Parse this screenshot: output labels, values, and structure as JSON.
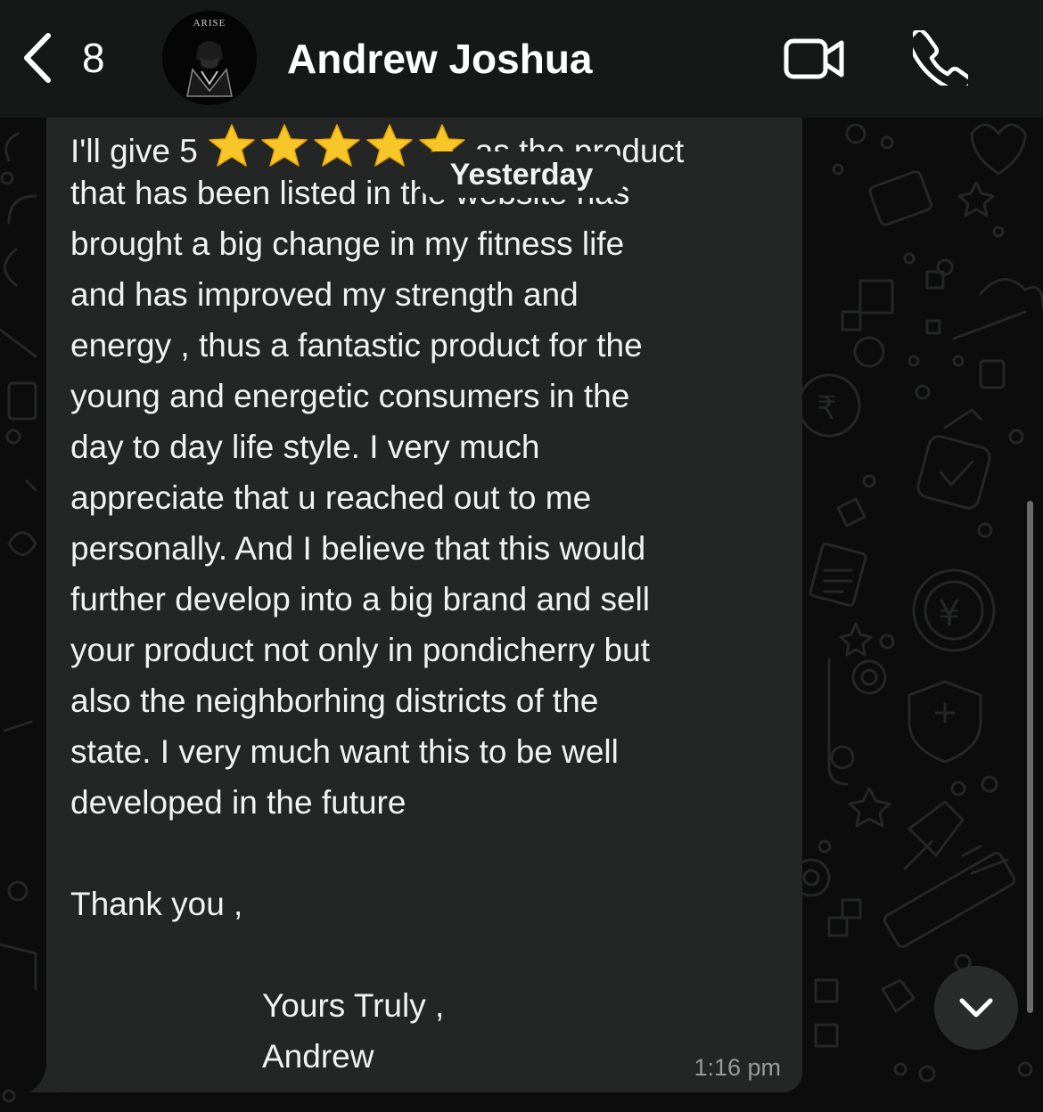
{
  "header": {
    "back_count": "8",
    "avatar_brand": "ARISE",
    "contact_name": "Andrew Joshua"
  },
  "message": {
    "first_line_before_stars": "I'll give 5",
    "star_count": 5,
    "first_line_after_stars": "as the product",
    "body_lines": [
      "that has been listed in the website has",
      "brought a big change in my fitness life",
      "and has improved my strength and",
      "energy , thus a fantastic product for the",
      "young and energetic consumers in the",
      "day to day life style. I very much",
      "appreciate that u reached out to me",
      "personally. And I believe that this would",
      "further develop into a big brand and sell",
      "your product not only in pondicherry but",
      "also the neighborhing districts of the",
      "state. I very much want this to be well",
      "developed in the future"
    ],
    "closing": "Thank you ,",
    "signoff_line1": "Yours Truly ,",
    "signoff_line2": "Andrew",
    "time": "1:16 pm"
  },
  "date_separator": "Yesterday",
  "icons": {
    "back": "chevron-left-icon",
    "video": "video-camera-icon",
    "call": "phone-icon",
    "star": "star-icon",
    "scroll": "chevron-down-icon"
  },
  "colors": {
    "background": "#0c0c0c",
    "header": "#161717",
    "bubble": "#242626",
    "text": "#f2f2f2",
    "timestamp": "#9a9a9a",
    "star": "#f7c629"
  }
}
